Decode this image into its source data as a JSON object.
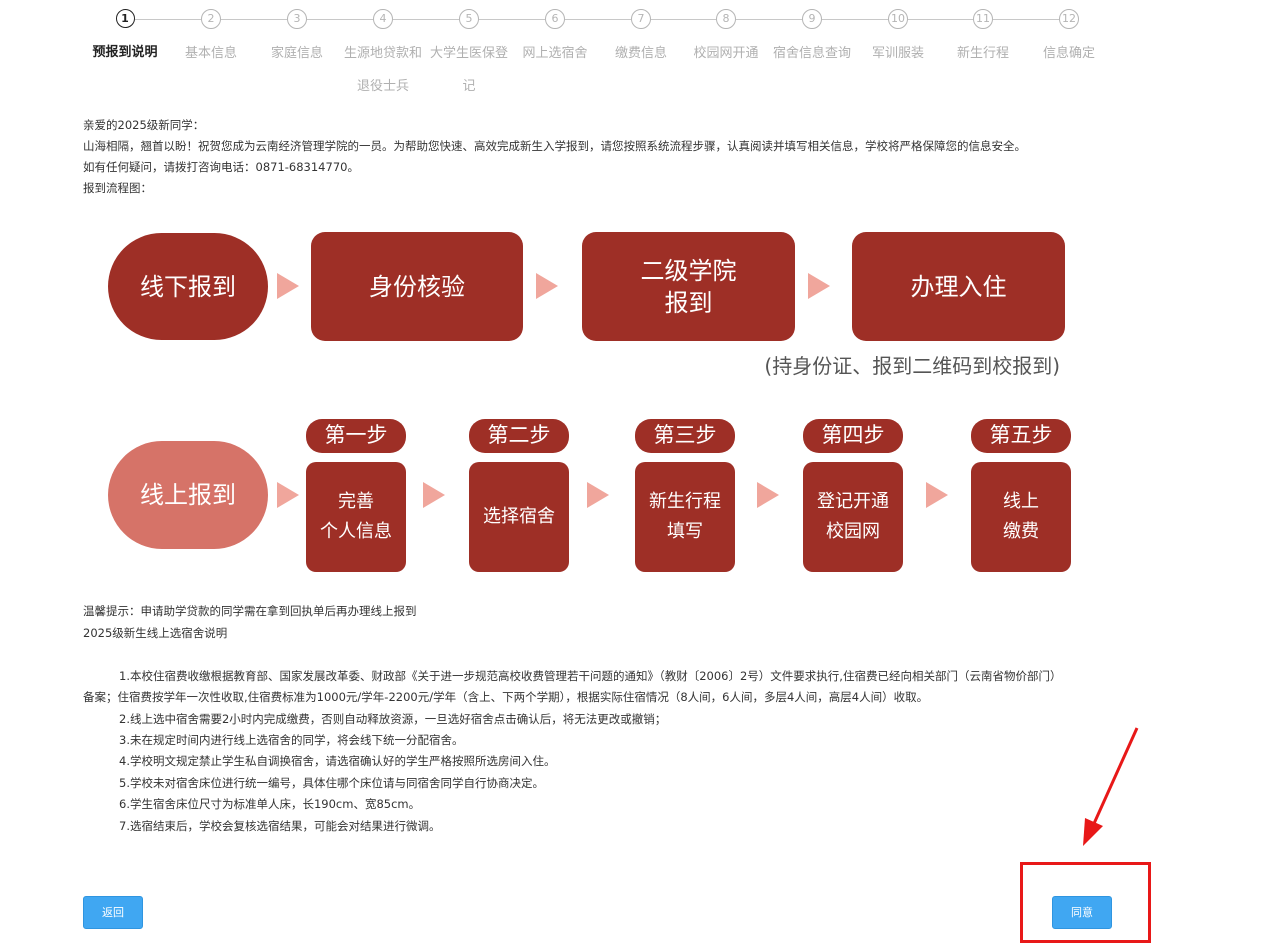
{
  "steps": [
    {
      "num": "1",
      "label": "预报到说明",
      "active": true
    },
    {
      "num": "2",
      "label": "基本信息"
    },
    {
      "num": "3",
      "label": "家庭信息"
    },
    {
      "num": "4",
      "label": "生源地贷款和退役士兵"
    },
    {
      "num": "5",
      "label": "大学生医保登记"
    },
    {
      "num": "6",
      "label": "网上选宿舍"
    },
    {
      "num": "7",
      "label": "缴费信息"
    },
    {
      "num": "8",
      "label": "校园网开通"
    },
    {
      "num": "9",
      "label": "宿舍信息查询"
    },
    {
      "num": "10",
      "label": "军训服装"
    },
    {
      "num": "11",
      "label": "新生行程"
    },
    {
      "num": "12",
      "label": "信息确定"
    }
  ],
  "intro": {
    "greeting": "亲爱的2025级新同学：",
    "welcome": "山海相隔，翘首以盼！祝贺您成为云南经济管理学院的一员。为帮助您快速、高效完成新生入学报到，请您按照系统流程步骤，认真阅读并填写相关信息，学校将严格保障您的信息安全。",
    "contact": "如有任何疑问，请拨打咨询电话：0871-68314770。",
    "flow_title": "报到流程图："
  },
  "flow": {
    "offline": {
      "start": "线下报到",
      "s1": "身份核验",
      "s2_l1": "二级学院",
      "s2_l2": "报到",
      "s3": "办理入住",
      "note": "(持身份证、报到二维码到校报到)"
    },
    "online": {
      "start": "线上报到",
      "tags": [
        "第一步",
        "第二步",
        "第三步",
        "第四步",
        "第五步"
      ],
      "items": [
        {
          "l1": "完善",
          "l2": "个人信息"
        },
        {
          "l1": "选择宿舍",
          "l2": ""
        },
        {
          "l1": "新生行程",
          "l2": "填写"
        },
        {
          "l1": "登记开通",
          "l2": "校园网"
        },
        {
          "l1": "线上",
          "l2": "缴费"
        }
      ]
    }
  },
  "tips": {
    "warm": "温馨提示：申请助学贷款的同学需在拿到回执单后再办理线上报到",
    "dorm_title": "2025级新生线上选宿舍说明"
  },
  "rules": {
    "r1a": "1.本校住宿费收缴根据教育部、国家发展改革委、财政部《关于进一步规范高校收费管理若干问题的通知》（教财〔2006〕2号）文件要求执行,住宿费已经向相关部门（云南省物价部门）",
    "r1b": "备案；住宿费按学年一次性收取,住宿费标准为1000元/学年-2200元/学年（含上、下两个学期），根据实际住宿情况（8人间，6人间，多层4人间，高层4人间）收取。",
    "r2": "2.线上选中宿舍需要2小时内完成缴费，否则自动释放资源，一旦选好宿舍点击确认后，将无法更改或撤销；",
    "r3": "3.未在规定时间内进行线上选宿舍的同学，将会线下统一分配宿舍。",
    "r4": "4.学校明文规定禁止学生私自调换宿舍，请选宿确认好的学生严格按照所选房间入住。",
    "r5": "5.学校未对宿舍床位进行统一编号，具体住哪个床位请与同宿舍同学自行协商决定。",
    "r6": "6.学生宿舍床位尺寸为标准单人床，长190cm、宽85cm。",
    "r7": "7.选宿结束后，学校会复核选宿结果，可能会对结果进行微调。"
  },
  "buttons": {
    "back": "返回",
    "agree": "同意"
  },
  "colors": {
    "dark_red": "#9e2f26",
    "light_red": "#d67368",
    "arrow": "#f0a69c",
    "button_blue": "#40a7f2",
    "highlight": "#e81818"
  }
}
